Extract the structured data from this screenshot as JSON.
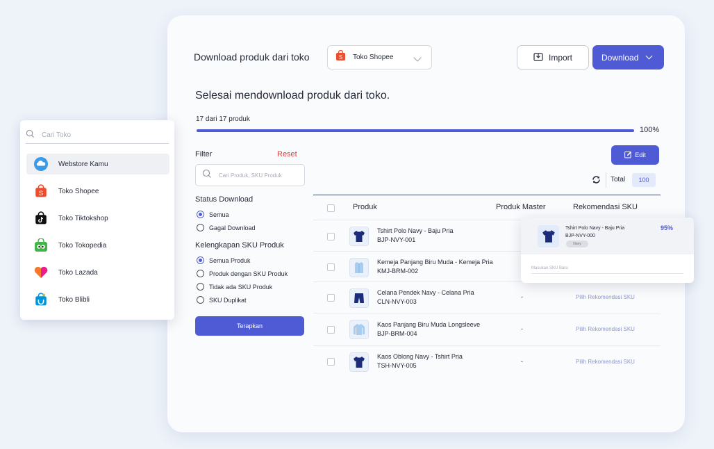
{
  "header": {
    "title": "Download produk dari toko",
    "store_select": {
      "icon": "shopee-bag-icon",
      "value": "Toko Shopee"
    },
    "import_label": "Import",
    "download_label": "Download"
  },
  "status": {
    "title": "Selesai mendownload produk dari toko.",
    "progress_text": "17 dari 17 produk",
    "progress_percent": 100,
    "progress_label": "100%"
  },
  "filter": {
    "label": "Filter",
    "reset_label": "Reset",
    "search_placeholder": "Cari Produk, SKU Produk",
    "status_download": {
      "title": "Status Download",
      "options": [
        {
          "label": "Semua",
          "selected": true
        },
        {
          "label": "Gagal Download",
          "selected": false
        }
      ]
    },
    "kelengkapan": {
      "title": "Kelengkapan SKU Produk",
      "options": [
        {
          "label": "Semua Produk",
          "selected": true
        },
        {
          "label": "Produk dengan SKU Produk",
          "selected": false
        },
        {
          "label": "Tidak ada SKU Produk",
          "selected": false
        },
        {
          "label": "SKU Duplikat",
          "selected": false
        }
      ]
    },
    "apply_label": "Terapkan"
  },
  "toolbar": {
    "edit_label": "Edit",
    "total_label": "Total",
    "total_value": "100"
  },
  "table": {
    "headers": {
      "produk": "Produk",
      "master": "Produk Master",
      "rekomendasi": "Rekomendasi SKU"
    },
    "rows": [
      {
        "name": "Tshirt Polo Navy - Baju Pria",
        "sku": "BJP-NVY-001",
        "master": "",
        "rekomendasi": "",
        "thumb": "navy-shirt-icon"
      },
      {
        "name": "Kemeja Panjang Biru Muda - Kemeja Pria",
        "sku": "KMJ-BRM-002",
        "master": "",
        "rekomendasi": "",
        "thumb": "light-blue-shirt-icon"
      },
      {
        "name": "Celana Pendek Navy - Celana Pria",
        "sku": "CLN-NVY-003",
        "master": "-",
        "rekomendasi": "Pilih Rekomendasi SKU",
        "thumb": "navy-shorts-icon"
      },
      {
        "name": "Kaos Panjang Biru Muda Longsleeve",
        "sku": "BJP-BRM-004",
        "master": "-",
        "rekomendasi": "Pilih Rekomendasi SKU",
        "thumb": "light-blue-longsleeve-icon"
      },
      {
        "name": "Kaos Oblong Navy - Tshirt Pria",
        "sku": "TSH-NVY-005",
        "master": "-",
        "rekomendasi": "Pilih Rekomendasi SKU",
        "thumb": "navy-tshirt-icon"
      }
    ]
  },
  "recommendation_popup": {
    "name": "Tshirt Polo Navy - Baju Pria",
    "sku": "BJP-NVY-000",
    "chip": "Navy",
    "match": "95%",
    "input_placeholder": "Masukan SKU Baru"
  },
  "store_panel": {
    "search_placeholder": "Cari Toko",
    "items": [
      {
        "label": "Webstore Kamu",
        "icon": "webstore-cloud-icon",
        "active": true
      },
      {
        "label": "Toko Shopee",
        "icon": "shopee-bag-icon",
        "active": false
      },
      {
        "label": "Toko Tiktokshop",
        "icon": "tiktok-bag-icon",
        "active": false
      },
      {
        "label": "Toko Tokopedia",
        "icon": "tokopedia-bag-icon",
        "active": false
      },
      {
        "label": "Toko Lazada",
        "icon": "lazada-heart-icon",
        "active": false
      },
      {
        "label": "Toko Blibli",
        "icon": "blibli-bag-icon",
        "active": false
      }
    ]
  },
  "colors": {
    "primary": "#4f5bd5",
    "danger": "#e23b3b",
    "link_muted": "#8d97c9"
  }
}
